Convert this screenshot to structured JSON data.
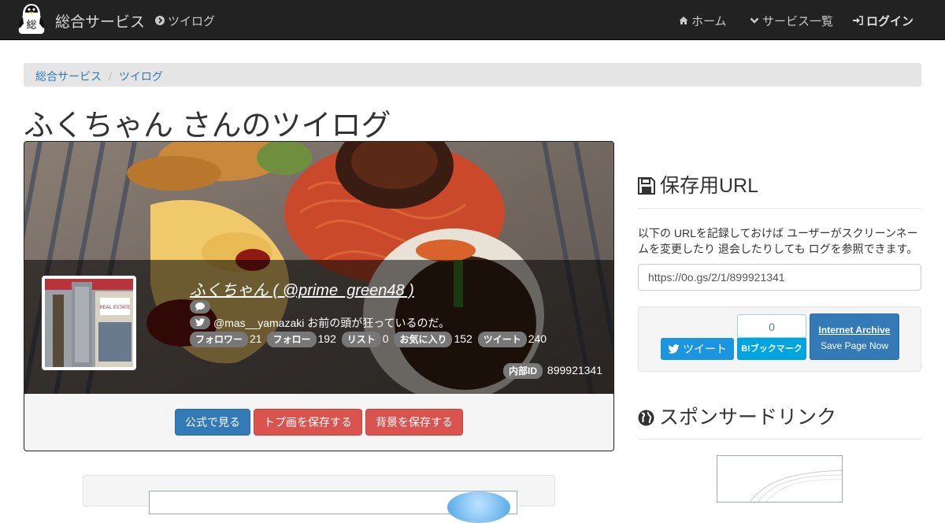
{
  "navbar": {
    "brand": "総合サービス",
    "tweetlog": "ツイログ",
    "home": "ホーム",
    "services": "サービス一覧",
    "login": "ログイン",
    "logo_char": "総"
  },
  "breadcrumb": [
    "総合サービス",
    "ツイログ"
  ],
  "page_title": "ふくちゃん さんのツイログ",
  "profile": {
    "name_line": "ふくちゃん ( @prime_green48 )",
    "twitter_line": "@mas__yamazaki お前の頭が狂っているのだ。",
    "stats": [
      {
        "label": "フォロワー",
        "value": "21"
      },
      {
        "label": "フォロー",
        "value": "192"
      },
      {
        "label": "リスト",
        "value": "0"
      },
      {
        "label": "お気に入り",
        "value": "152"
      },
      {
        "label": "ツイート",
        "value": "240"
      }
    ],
    "internal_id_label": "内部ID",
    "internal_id": "899921341",
    "avatar_sign_text": "REAL ESTATE"
  },
  "actions": {
    "official": "公式で見る",
    "save_top": "トプ画を保存する",
    "save_bg": "背景を保存する"
  },
  "save_section": {
    "heading": "保存用URL",
    "description": "以下の URLを記録しておけば ユーザーがスクリーンネームを変更したり 退会したりしても ログを参照できます。",
    "url": "https://0o.gs/2/1/899921341"
  },
  "share": {
    "tweet": "ツイート",
    "hatena_count": "0",
    "hatena_label": "B!ブックマーク",
    "ia_title": "Internet Archive",
    "ia_sub": "Save Page Now"
  },
  "sponsor": {
    "heading": "スポンサードリンク"
  },
  "colors": {
    "navbar": "#222222",
    "primary": "#337ab7",
    "danger": "#d9534f",
    "twitter": "#1b95e0",
    "hatena": "#00a4de"
  }
}
